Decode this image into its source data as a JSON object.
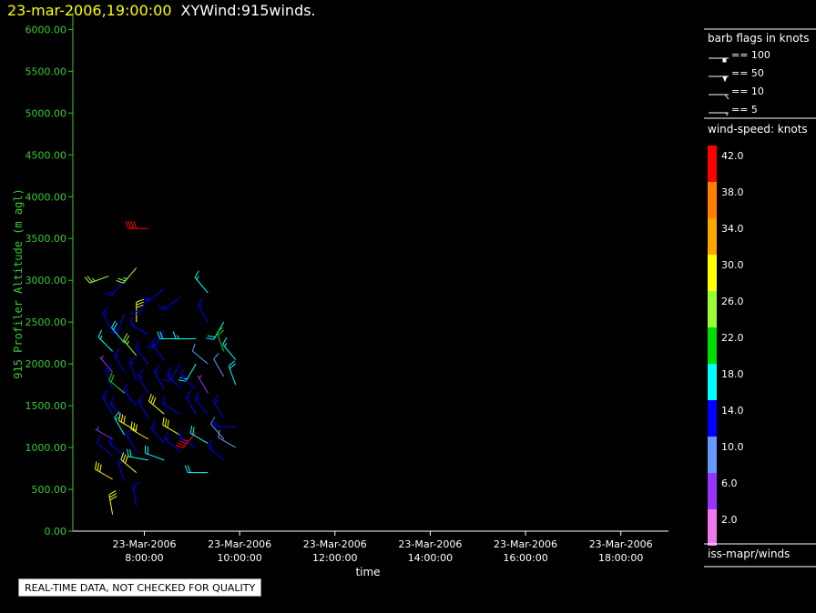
{
  "header": {
    "timestamp": "23-mar-2006,19:00:00",
    "product": "XYWind:915winds."
  },
  "notice": "REAL-TIME DATA, NOT CHECKED FOR QUALITY",
  "colors": {
    "axis": "#33cc33",
    "background": "#000000",
    "foreground": "#ffffff"
  },
  "legend": {
    "barb_title": "barb flags in knots",
    "barb_entries": [
      "== 100",
      "== 50",
      "== 10",
      "== 5"
    ],
    "speed_title": "wind-speed: knots",
    "speed_labels": [
      "42.0",
      "38.0",
      "34.0",
      "30.0",
      "26.0",
      "22.0",
      "18.0",
      "14.0",
      "10.0",
      "6.0",
      "2.0"
    ],
    "speed_colors": [
      "#ff0000",
      "#ff7f00",
      "#ffa500",
      "#ffff00",
      "#99ff33",
      "#00dd00",
      "#00ffff",
      "#0000ff",
      "#6699ff",
      "#9933ff",
      "#ee77ee"
    ],
    "source": "iss-mapr/winds"
  },
  "chart_data": {
    "type": "scatter",
    "title": "",
    "xlabel": "time",
    "ylabel": "915 Profiler Altitude (m agl)",
    "ylim": [
      0,
      6200
    ],
    "xlim": [
      "2006-03-23 06:30",
      "2006-03-23 19:00"
    ],
    "y_ticks": [
      "0.00",
      "500.00",
      "1000.00",
      "1500.00",
      "2000.00",
      "2500.00",
      "3000.00",
      "3500.00",
      "4000.00",
      "4500.00",
      "5000.00",
      "5500.00",
      "6000.00"
    ],
    "x_ticks": [
      {
        "date": "23-Mar-2006",
        "time": "8:00:00"
      },
      {
        "date": "23-Mar-2006",
        "time": "10:00:00"
      },
      {
        "date": "23-Mar-2006",
        "time": "12:00:00"
      },
      {
        "date": "23-Mar-2006",
        "time": "14:00:00"
      },
      {
        "date": "23-Mar-2006",
        "time": "16:00:00"
      },
      {
        "date": "23-Mar-2006",
        "time": "18:00:00"
      }
    ],
    "barbs": [
      {
        "t": "2006-03-23 07:15",
        "alt": 3050,
        "spd": 24,
        "dir": 250
      },
      {
        "t": "2006-03-23 07:20",
        "alt": 2400,
        "spd": 14,
        "dir": 330
      },
      {
        "t": "2006-03-23 07:20",
        "alt": 2150,
        "spd": 16,
        "dir": 315
      },
      {
        "t": "2006-03-23 07:20",
        "alt": 1900,
        "spd": 7,
        "dir": 320
      },
      {
        "t": "2006-03-23 07:20",
        "alt": 1700,
        "spd": 14,
        "dir": 340
      },
      {
        "t": "2006-03-23 07:20",
        "alt": 1400,
        "spd": 13,
        "dir": 330
      },
      {
        "t": "2006-03-23 07:20",
        "alt": 1100,
        "spd": 7,
        "dir": 300
      },
      {
        "t": "2006-03-23 07:20",
        "alt": 900,
        "spd": 12,
        "dir": 310
      },
      {
        "t": "2006-03-23 07:20",
        "alt": 620,
        "spd": 28,
        "dir": 300
      },
      {
        "t": "2006-03-23 07:20",
        "alt": 200,
        "spd": 28,
        "dir": 350
      },
      {
        "t": "2006-03-23 07:35",
        "alt": 3000,
        "spd": 14,
        "dir": 220
      },
      {
        "t": "2006-03-23 07:35",
        "alt": 2600,
        "spd": 13,
        "dir": 200
      },
      {
        "t": "2006-03-23 07:35",
        "alt": 2250,
        "spd": 18,
        "dir": 320
      },
      {
        "t": "2006-03-23 07:35",
        "alt": 1900,
        "spd": 15,
        "dir": 330
      },
      {
        "t": "2006-03-23 07:35",
        "alt": 1650,
        "spd": 20,
        "dir": 310
      },
      {
        "t": "2006-03-23 07:35",
        "alt": 1350,
        "spd": 14,
        "dir": 315
      },
      {
        "t": "2006-03-23 07:35",
        "alt": 1150,
        "spd": 16,
        "dir": 330
      },
      {
        "t": "2006-03-23 07:35",
        "alt": 900,
        "spd": 14,
        "dir": 310
      },
      {
        "t": "2006-03-23 07:35",
        "alt": 600,
        "spd": 14,
        "dir": 340
      },
      {
        "t": "2006-03-23 07:50",
        "alt": 3150,
        "spd": 24,
        "dir": 220
      },
      {
        "t": "2006-03-23 07:50",
        "alt": 2500,
        "spd": 30,
        "dir": 0
      },
      {
        "t": "2006-03-23 07:50",
        "alt": 2100,
        "spd": 26,
        "dir": 320
      },
      {
        "t": "2006-03-23 07:50",
        "alt": 1800,
        "spd": 14,
        "dir": 340
      },
      {
        "t": "2006-03-23 07:50",
        "alt": 1500,
        "spd": 14,
        "dir": 320
      },
      {
        "t": "2006-03-23 07:50",
        "alt": 1200,
        "spd": 30,
        "dir": 300
      },
      {
        "t": "2006-03-23 07:50",
        "alt": 950,
        "spd": 14,
        "dir": 330
      },
      {
        "t": "2006-03-23 07:50",
        "alt": 700,
        "spd": 28,
        "dir": 310
      },
      {
        "t": "2006-03-23 07:50",
        "alt": 300,
        "spd": 14,
        "dir": 350
      },
      {
        "t": "2006-03-23 08:05",
        "alt": 3620,
        "spd": 42,
        "dir": 270
      },
      {
        "t": "2006-03-23 08:05",
        "alt": 2800,
        "spd": 14,
        "dir": 210
      },
      {
        "t": "2006-03-23 08:05",
        "alt": 2350,
        "spd": 14,
        "dir": 300
      },
      {
        "t": "2006-03-23 08:05",
        "alt": 2000,
        "spd": 15,
        "dir": 320
      },
      {
        "t": "2006-03-23 08:05",
        "alt": 1650,
        "spd": 14,
        "dir": 330
      },
      {
        "t": "2006-03-23 08:05",
        "alt": 1350,
        "spd": 14,
        "dir": 330
      },
      {
        "t": "2006-03-23 08:05",
        "alt": 1100,
        "spd": 30,
        "dir": 300
      },
      {
        "t": "2006-03-23 08:05",
        "alt": 850,
        "spd": 18,
        "dir": 280
      },
      {
        "t": "2006-03-23 08:25",
        "alt": 2900,
        "spd": 14,
        "dir": 230
      },
      {
        "t": "2006-03-23 08:25",
        "alt": 2400,
        "spd": 14,
        "dir": 210
      },
      {
        "t": "2006-03-23 08:25",
        "alt": 2050,
        "spd": 14,
        "dir": 320
      },
      {
        "t": "2006-03-23 08:25",
        "alt": 1700,
        "spd": 14,
        "dir": 330
      },
      {
        "t": "2006-03-23 08:25",
        "alt": 1400,
        "spd": 30,
        "dir": 310
      },
      {
        "t": "2006-03-23 08:25",
        "alt": 1050,
        "spd": 14,
        "dir": 320
      },
      {
        "t": "2006-03-23 08:25",
        "alt": 850,
        "spd": 18,
        "dir": 290
      },
      {
        "t": "2006-03-23 08:45",
        "alt": 2800,
        "spd": 14,
        "dir": 230
      },
      {
        "t": "2006-03-23 08:45",
        "alt": 2300,
        "spd": 18,
        "dir": 270
      },
      {
        "t": "2006-03-23 08:45",
        "alt": 2000,
        "spd": 14,
        "dir": 210
      },
      {
        "t": "2006-03-23 08:45",
        "alt": 1700,
        "spd": 14,
        "dir": 320
      },
      {
        "t": "2006-03-23 08:45",
        "alt": 1400,
        "spd": 14,
        "dir": 300
      },
      {
        "t": "2006-03-23 08:45",
        "alt": 1150,
        "spd": 30,
        "dir": 300
      },
      {
        "t": "2006-03-23 08:45",
        "alt": 950,
        "spd": 14,
        "dir": 310
      },
      {
        "t": "2006-03-23 09:05",
        "alt": 2300,
        "spd": 16,
        "dir": 270
      },
      {
        "t": "2006-03-23 09:05",
        "alt": 2000,
        "spd": 18,
        "dir": 210
      },
      {
        "t": "2006-03-23 09:05",
        "alt": 1700,
        "spd": 14,
        "dir": 310
      },
      {
        "t": "2006-03-23 09:05",
        "alt": 1400,
        "spd": 14,
        "dir": 330
      },
      {
        "t": "2006-03-23 09:05",
        "alt": 1180,
        "spd": 40,
        "dir": 220
      },
      {
        "t": "2006-03-23 09:05",
        "alt": 1000,
        "spd": 14,
        "dir": 300
      },
      {
        "t": "2006-03-23 09:20",
        "alt": 2850,
        "spd": 17,
        "dir": 320
      },
      {
        "t": "2006-03-23 09:20",
        "alt": 2500,
        "spd": 14,
        "dir": 330
      },
      {
        "t": "2006-03-23 09:20",
        "alt": 2000,
        "spd": 8,
        "dir": 310
      },
      {
        "t": "2006-03-23 09:20",
        "alt": 1650,
        "spd": 7,
        "dir": 330
      },
      {
        "t": "2006-03-23 09:20",
        "alt": 1400,
        "spd": 14,
        "dir": 320
      },
      {
        "t": "2006-03-23 09:20",
        "alt": 1050,
        "spd": 18,
        "dir": 300
      },
      {
        "t": "2006-03-23 09:20",
        "alt": 700,
        "spd": 18,
        "dir": 270
      },
      {
        "t": "2006-03-23 09:40",
        "alt": 2500,
        "spd": 18,
        "dir": 210
      },
      {
        "t": "2006-03-23 09:40",
        "alt": 2150,
        "spd": 20,
        "dir": 340
      },
      {
        "t": "2006-03-23 09:40",
        "alt": 1850,
        "spd": 8,
        "dir": 330
      },
      {
        "t": "2006-03-23 09:40",
        "alt": 1350,
        "spd": 14,
        "dir": 330
      },
      {
        "t": "2006-03-23 09:40",
        "alt": 1100,
        "spd": 8,
        "dir": 320
      },
      {
        "t": "2006-03-23 09:40",
        "alt": 850,
        "spd": 14,
        "dir": 310
      },
      {
        "t": "2006-03-23 09:55",
        "alt": 2050,
        "spd": 16,
        "dir": 320
      },
      {
        "t": "2006-03-23 09:55",
        "alt": 1750,
        "spd": 18,
        "dir": 340
      },
      {
        "t": "2006-03-23 09:55",
        "alt": 1250,
        "spd": 14,
        "dir": 270
      },
      {
        "t": "2006-03-23 09:55",
        "alt": 1000,
        "spd": 8,
        "dir": 300
      }
    ]
  }
}
